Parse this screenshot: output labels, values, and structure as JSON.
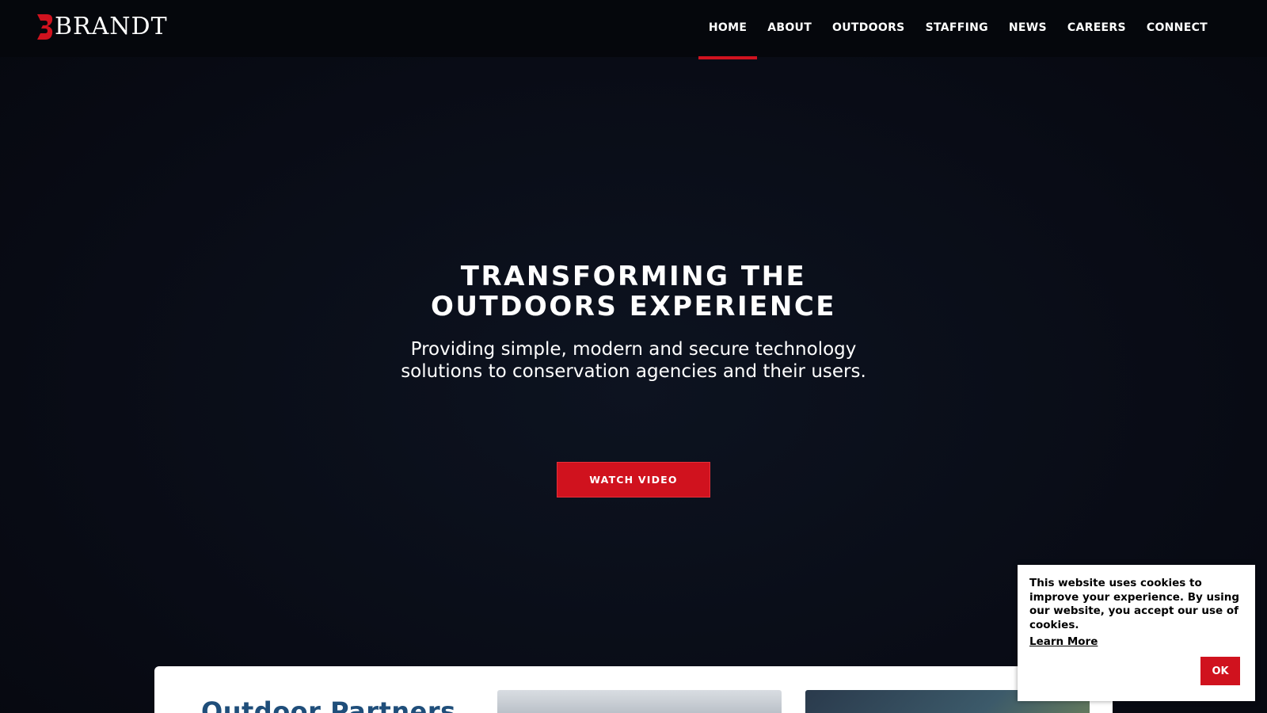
{
  "brand": {
    "logo_text": "BRANDT",
    "accent_color": "#d0121e"
  },
  "nav": {
    "items": [
      {
        "label": "HOME",
        "active": true
      },
      {
        "label": "ABOUT",
        "active": false
      },
      {
        "label": "OUTDOORS",
        "active": false
      },
      {
        "label": "STAFFING",
        "active": false
      },
      {
        "label": "NEWS",
        "active": false
      },
      {
        "label": "CAREERS",
        "active": false
      },
      {
        "label": "CONNECT",
        "active": false
      }
    ]
  },
  "hero": {
    "title_line1": "TRANSFORMING THE",
    "title_line2": "OUTDOORS EXPERIENCE",
    "subtitle": "Providing simple, modern and secure technology solutions to conservation agencies and their users.",
    "button_label": "WATCH VIDEO"
  },
  "partners": {
    "title": "Outdoor Partners"
  },
  "cookie": {
    "message": "This website uses cookies to improve your experience. By using our website, you accept our use of cookies.",
    "learn_more": "Learn More",
    "ok_label": "OK"
  }
}
